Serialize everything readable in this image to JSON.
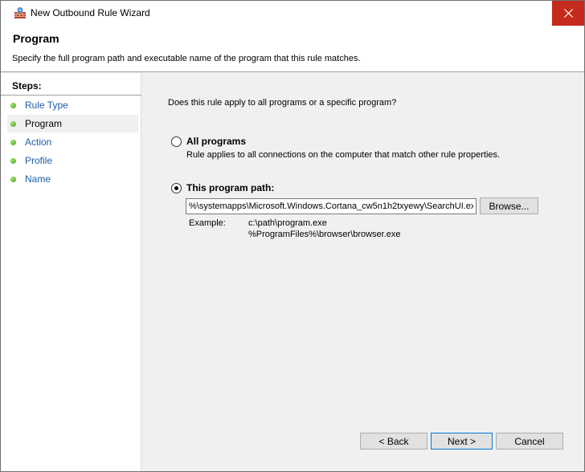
{
  "window": {
    "title": "New Outbound Rule Wizard"
  },
  "header": {
    "title": "Program",
    "description": "Specify the full program path and executable name of the program that this rule matches."
  },
  "steps": {
    "heading": "Steps:",
    "items": [
      {
        "label": "Rule Type"
      },
      {
        "label": "Program"
      },
      {
        "label": "Action"
      },
      {
        "label": "Profile"
      },
      {
        "label": "Name"
      }
    ],
    "active_index": 1
  },
  "content": {
    "question": "Does this rule apply to all programs or a specific program?",
    "all_programs": {
      "label": "All programs",
      "description": "Rule applies to all connections on the computer that match other rule properties.",
      "checked": false
    },
    "this_program": {
      "label": "This program path:",
      "checked": true,
      "value": "%\\systemapps\\Microsoft.Windows.Cortana_cw5n1h2txyewy\\SearchUI.exe",
      "browse_label": "Browse..."
    },
    "example": {
      "label": "Example:",
      "lines": [
        "c:\\path\\program.exe",
        "%ProgramFiles%\\browser\\browser.exe"
      ]
    }
  },
  "buttons": {
    "back": "< Back",
    "next": "Next >",
    "cancel": "Cancel"
  },
  "colors": {
    "close_button": "#c42b1c",
    "step_link": "#1f5ba8",
    "step_dot": "#3fa11f",
    "primary_border": "#0078d7"
  },
  "icons": {
    "app": "firewall-wall-icon",
    "close": "close-icon",
    "step": "green-dot-icon"
  }
}
